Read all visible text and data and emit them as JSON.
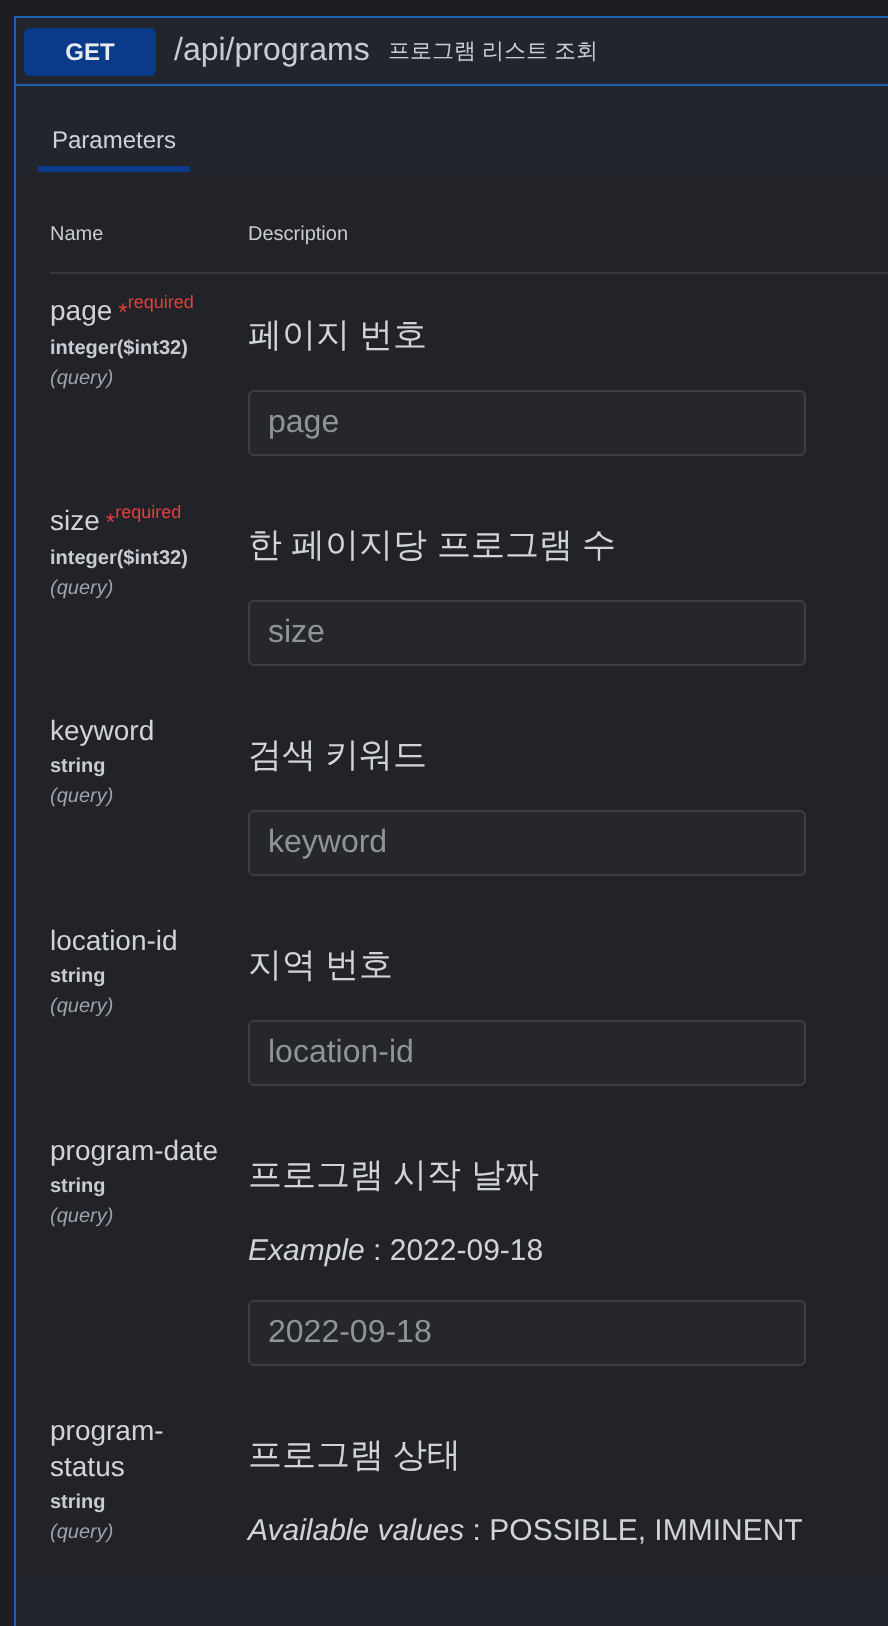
{
  "operation": {
    "method": "GET",
    "path": "/api/programs",
    "summary": "프로그램 리스트 조회"
  },
  "tabs": [
    {
      "label": "Parameters",
      "selected": true
    }
  ],
  "table": {
    "columns": [
      "Name",
      "Description"
    ]
  },
  "parameters": [
    {
      "name": "page",
      "required_mark": "*",
      "required_label": "required",
      "type": "integer($int32)",
      "in": "(query)",
      "description": "페이지 번호",
      "placeholder": "page"
    },
    {
      "name": "size",
      "required_mark": "*",
      "required_label": "required",
      "type": "integer($int32)",
      "in": "(query)",
      "description": "한 페이지당 프로그램 수",
      "placeholder": "size"
    },
    {
      "name": "keyword",
      "type": "string",
      "in": "(query)",
      "description": "검색 키워드",
      "placeholder": "keyword"
    },
    {
      "name": "location-id",
      "type": "string",
      "in": "(query)",
      "description": "지역 번호",
      "placeholder": "location-id"
    },
    {
      "name": "program-date",
      "type": "string",
      "in": "(query)",
      "description": "프로그램 시작 날짜",
      "example": "*Example* : 2022-09-18",
      "placeholder": "2022-09-18"
    },
    {
      "name": "program-status",
      "type": "string",
      "in": "(query)",
      "description": "프로그램 상태",
      "example": "*Available values* : POSSIBLE, IMMINENT"
    }
  ]
}
